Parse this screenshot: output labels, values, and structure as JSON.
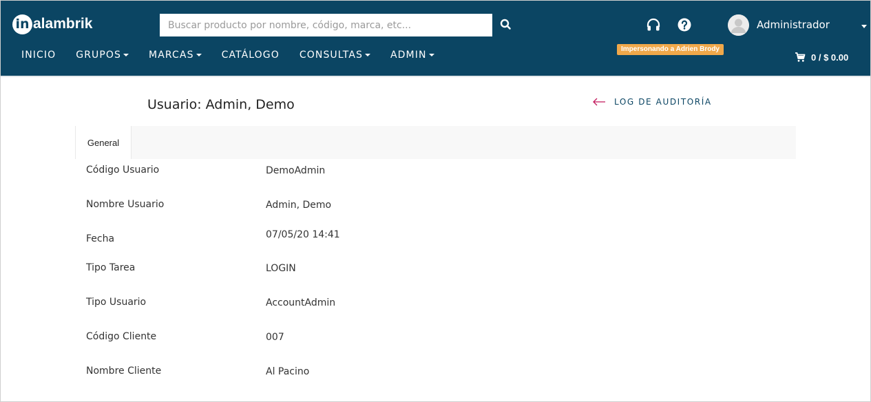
{
  "header": {
    "logo_mark": "in",
    "logo_text": "alambrik",
    "search_placeholder": "Buscar producto por nombre, código, marca, etc...",
    "user_name": "Administrador",
    "impersonation_badge": "Impersonando a Adrien Brody",
    "cart_summary": "0 / $ 0.00"
  },
  "nav": {
    "items": [
      {
        "label": "INICIO",
        "dropdown": false
      },
      {
        "label": "GRUPOS",
        "dropdown": true
      },
      {
        "label": "MARCAS",
        "dropdown": true
      },
      {
        "label": "CATÁLOGO",
        "dropdown": false
      },
      {
        "label": "CONSULTAS",
        "dropdown": true
      },
      {
        "label": "ADMIN",
        "dropdown": true
      }
    ]
  },
  "page": {
    "title": "Usuario: Admin, Demo",
    "audit_link": "LOG DE AUDITORÍA"
  },
  "tabs": [
    {
      "label": "General",
      "active": true
    }
  ],
  "fields": [
    {
      "label": "Código Usuario",
      "value": "DemoAdmin"
    },
    {
      "label": "Nombre Usuario",
      "value": "Admin, Demo"
    },
    {
      "label": "Fecha",
      "value": "07/05/20 14:41"
    },
    {
      "label": "Tipo Tarea",
      "value": "LOGIN"
    },
    {
      "label": "Tipo Usuario",
      "value": "AccountAdmin"
    },
    {
      "label": "Código Cliente",
      "value": "007"
    },
    {
      "label": "Nombre Cliente",
      "value": "Al Pacino"
    }
  ],
  "icons": {
    "search": "search-icon",
    "support": "headset-icon",
    "help": "question-circle-icon",
    "avatar": "user-avatar-icon",
    "cart": "cart-icon",
    "back": "arrow-left-icon"
  },
  "colors": {
    "header_bg": "#0b4563",
    "badge_bg": "#f0a84a",
    "back_arrow": "#c2185b",
    "tabbar_bg": "#f8f8f8"
  }
}
